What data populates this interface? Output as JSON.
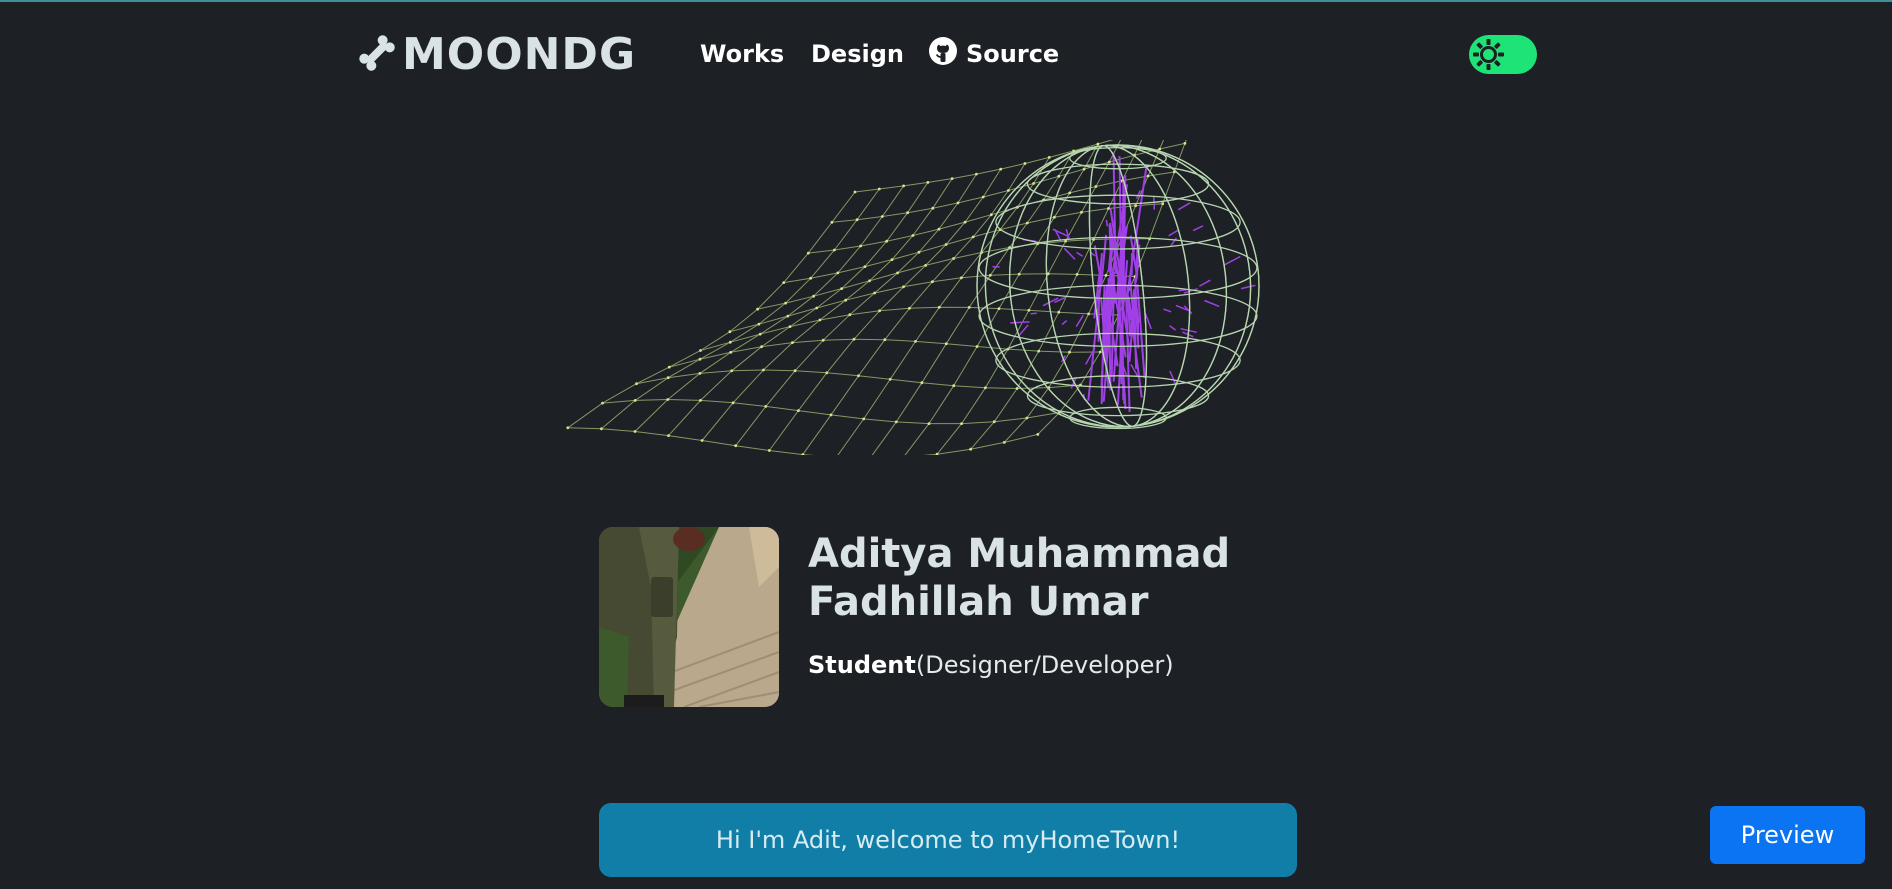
{
  "header": {
    "logo_text": "MOONDG",
    "logo_icon": "bone-icon",
    "nav": [
      {
        "label": "Works"
      },
      {
        "label": "Design"
      },
      {
        "label": "Source",
        "icon": "github-icon"
      }
    ],
    "theme_toggle_icon": "sun-icon"
  },
  "profile": {
    "name": "Aditya Muhammad Fadhillah Umar",
    "role_bold": "Student",
    "role_detail": "(Designer/Developer)"
  },
  "banner": {
    "text": "Hi I'm Adit, welcome to myHomeTown!"
  },
  "preview_button": {
    "label": "Preview"
  },
  "colors": {
    "background": "#1d2025",
    "toggle": "#1ee477",
    "banner": "#117ea8",
    "preview_button": "#0a74f2",
    "wireframe": "#b7d6b0",
    "sphere_core": "#a040e6"
  }
}
